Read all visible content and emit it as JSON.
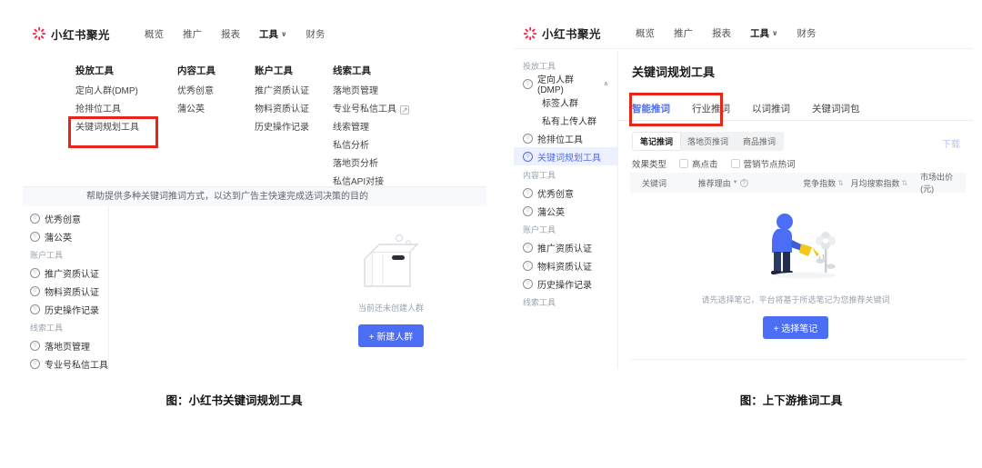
{
  "header": {
    "brand": "小红书聚光",
    "nav": [
      "概览",
      "推广",
      "报表",
      "工具",
      "财务"
    ]
  },
  "icons": {
    "chevron_down": "∨",
    "chevron_up": "∧",
    "external_link": "↗",
    "tool_glyph": "▽",
    "funnel": "▼",
    "question": "?",
    "sort": "⇅"
  },
  "dropdown": {
    "col1_title": "投放工具",
    "col1": [
      "定向人群(DMP)",
      "抢排位工具",
      "关键词规划工具"
    ],
    "col2_title": "内容工具",
    "col2": [
      "优秀创意",
      "蒲公英"
    ],
    "col3_title": "账户工具",
    "col3": [
      "推广资质认证",
      "物料资质认证",
      "历史操作记录"
    ],
    "col4_title": "线索工具",
    "col4": [
      "落地页管理",
      "专业号私信工具",
      "线索管理",
      "私信分析",
      "落地页分析",
      "私信API对接"
    ]
  },
  "left": {
    "banner": "帮助提供多种关键词推词方式，以达到广告主快速完成选词决策的目的",
    "sidebar": {
      "items_top": [
        "优秀创意",
        "蒲公英"
      ],
      "section1": "账户工具",
      "items_mid": [
        "推广资质认证",
        "物料资质认证",
        "历史操作记录"
      ],
      "section2": "线索工具",
      "items_bottom": [
        "落地页管理",
        "专业号私信工具"
      ]
    },
    "empty_text": "当前还未创建人群",
    "create_button": "+ 新建人群",
    "caption": "图：小红书关键词规划工具"
  },
  "right": {
    "sidebar": {
      "section1": "投放工具",
      "dmp": "定向人群(DMP)",
      "dmp_children": [
        "标签人群",
        "私有上传人群"
      ],
      "items1": [
        "抢排位工具",
        "关键词规划工具"
      ],
      "section2": "内容工具",
      "items2": [
        "优秀创意",
        "蒲公英"
      ],
      "section3": "账户工具",
      "items3": [
        "推广资质认证",
        "物料资质认证",
        "历史操作记录"
      ],
      "section4": "线索工具"
    },
    "page_title": "关键词规划工具",
    "tabs": [
      "智能推词",
      "行业推词",
      "以词推词",
      "关键词词包"
    ],
    "subtabs": [
      "笔记推词",
      "落地页推词",
      "商品推词"
    ],
    "download_link": "下载",
    "filter_label": "效果类型",
    "filter_options": [
      "高点击",
      "营销节点热词"
    ],
    "table_headers": [
      "关键词",
      "推荐理由",
      "竞争指数",
      "月均搜索指数",
      "市场出价(元)"
    ],
    "empty_text": "请先选择笔记，平台将基于所选笔记为您推荐关键词",
    "select_button": "+ 选择笔记",
    "caption": "图：上下游推词工具"
  },
  "colors": {
    "brand_red": "#ff2442",
    "accent_blue": "#4c6ef5",
    "highlight_box_red": "#e8251a",
    "active_item_bg": "#ecf0ff",
    "banner_bg": "#f7f9fc",
    "table_header_bg": "#f7f8fa"
  }
}
